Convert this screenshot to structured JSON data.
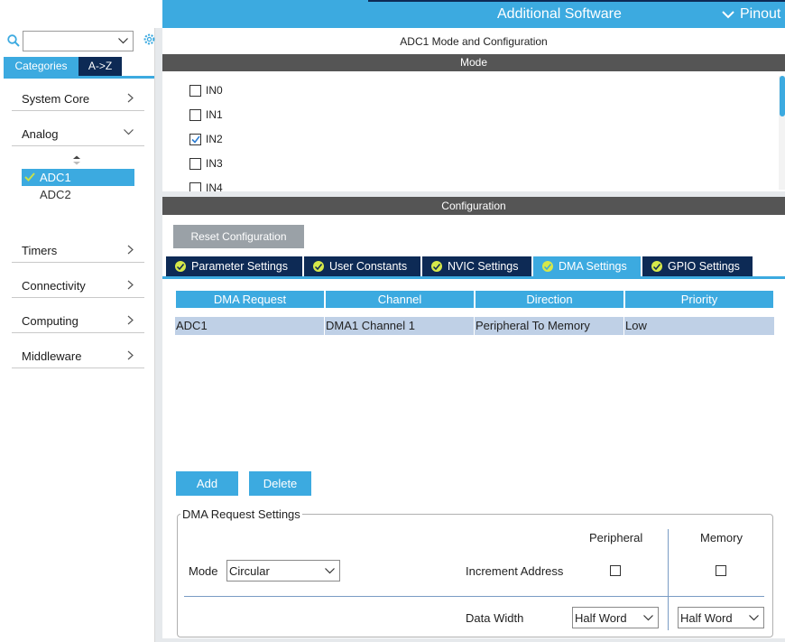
{
  "header": {
    "additional_software": "Additional Software",
    "pinout": "Pinout"
  },
  "sidebar": {
    "search_value": "",
    "tabs": {
      "categories": "Categories",
      "az": "A->Z"
    },
    "categories": [
      {
        "label": "System Core"
      },
      {
        "label": "Analog"
      },
      {
        "label": "Timers"
      },
      {
        "label": "Connectivity"
      },
      {
        "label": "Computing"
      },
      {
        "label": "Middleware"
      }
    ],
    "analog_items": [
      {
        "label": "ADC1",
        "selected": true,
        "enabled": true
      },
      {
        "label": "ADC2",
        "selected": false,
        "enabled": false
      }
    ]
  },
  "main": {
    "title": "ADC1 Mode and Configuration",
    "mode_header": "Mode",
    "mode_items": [
      {
        "label": "IN0",
        "checked": false
      },
      {
        "label": "IN1",
        "checked": false
      },
      {
        "label": "IN2",
        "checked": true
      },
      {
        "label": "IN3",
        "checked": false
      },
      {
        "label": "IN4",
        "checked": false
      }
    ],
    "config_header": "Configuration",
    "reset_label": "Reset Configuration",
    "config_tabs": [
      {
        "label": "Parameter Settings",
        "active": false
      },
      {
        "label": "User Constants",
        "active": false
      },
      {
        "label": "NVIC Settings",
        "active": false
      },
      {
        "label": "DMA Settings",
        "active": true
      },
      {
        "label": "GPIO Settings",
        "active": false
      }
    ],
    "dma_table": {
      "columns": [
        "DMA Request",
        "Channel",
        "Direction",
        "Priority"
      ],
      "rows": [
        [
          "ADC1",
          "DMA1 Channel 1",
          "Peripheral To Memory",
          "Low"
        ]
      ]
    },
    "add_label": "Add",
    "delete_label": "Delete",
    "dma_request_settings": {
      "title": "DMA Request Settings",
      "peripheral_header": "Peripheral",
      "memory_header": "Memory",
      "mode_label": "Mode",
      "mode_value": "Circular",
      "increment_label": "Increment Address",
      "increment_peripheral": false,
      "increment_memory": false,
      "data_width_label": "Data Width",
      "peripheral_width": "Half Word",
      "memory_width": "Half Word"
    }
  },
  "colors": {
    "accent": "#3caae0",
    "navy": "#0d2a55",
    "bar_gray": "#555555",
    "selected_row": "#bfd0e6",
    "tab_check": "#d6e84a"
  }
}
